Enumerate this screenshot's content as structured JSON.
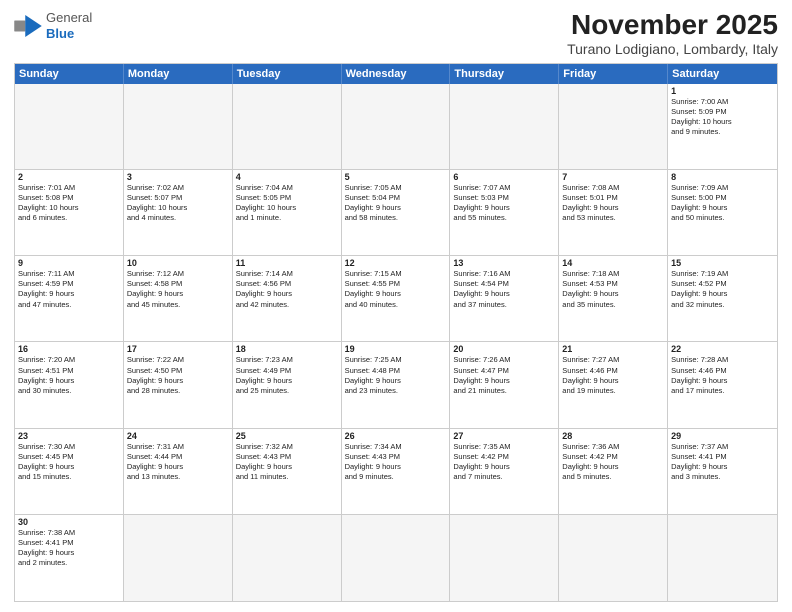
{
  "header": {
    "logo_general": "General",
    "logo_blue": "Blue",
    "month": "November 2025",
    "location": "Turano Lodigiano, Lombardy, Italy"
  },
  "weekdays": [
    "Sunday",
    "Monday",
    "Tuesday",
    "Wednesday",
    "Thursday",
    "Friday",
    "Saturday"
  ],
  "cells": [
    {
      "day": "",
      "content": "",
      "empty": true
    },
    {
      "day": "",
      "content": "",
      "empty": true
    },
    {
      "day": "",
      "content": "",
      "empty": true
    },
    {
      "day": "",
      "content": "",
      "empty": true
    },
    {
      "day": "",
      "content": "",
      "empty": true
    },
    {
      "day": "",
      "content": "",
      "empty": true
    },
    {
      "day": "1",
      "content": "Sunrise: 7:00 AM\nSunset: 5:09 PM\nDaylight: 10 hours\nand 9 minutes.",
      "empty": false
    },
    {
      "day": "2",
      "content": "Sunrise: 7:01 AM\nSunset: 5:08 PM\nDaylight: 10 hours\nand 6 minutes.",
      "empty": false
    },
    {
      "day": "3",
      "content": "Sunrise: 7:02 AM\nSunset: 5:07 PM\nDaylight: 10 hours\nand 4 minutes.",
      "empty": false
    },
    {
      "day": "4",
      "content": "Sunrise: 7:04 AM\nSunset: 5:05 PM\nDaylight: 10 hours\nand 1 minute.",
      "empty": false
    },
    {
      "day": "5",
      "content": "Sunrise: 7:05 AM\nSunset: 5:04 PM\nDaylight: 9 hours\nand 58 minutes.",
      "empty": false
    },
    {
      "day": "6",
      "content": "Sunrise: 7:07 AM\nSunset: 5:03 PM\nDaylight: 9 hours\nand 55 minutes.",
      "empty": false
    },
    {
      "day": "7",
      "content": "Sunrise: 7:08 AM\nSunset: 5:01 PM\nDaylight: 9 hours\nand 53 minutes.",
      "empty": false
    },
    {
      "day": "8",
      "content": "Sunrise: 7:09 AM\nSunset: 5:00 PM\nDaylight: 9 hours\nand 50 minutes.",
      "empty": false
    },
    {
      "day": "9",
      "content": "Sunrise: 7:11 AM\nSunset: 4:59 PM\nDaylight: 9 hours\nand 47 minutes.",
      "empty": false
    },
    {
      "day": "10",
      "content": "Sunrise: 7:12 AM\nSunset: 4:58 PM\nDaylight: 9 hours\nand 45 minutes.",
      "empty": false
    },
    {
      "day": "11",
      "content": "Sunrise: 7:14 AM\nSunset: 4:56 PM\nDaylight: 9 hours\nand 42 minutes.",
      "empty": false
    },
    {
      "day": "12",
      "content": "Sunrise: 7:15 AM\nSunset: 4:55 PM\nDaylight: 9 hours\nand 40 minutes.",
      "empty": false
    },
    {
      "day": "13",
      "content": "Sunrise: 7:16 AM\nSunset: 4:54 PM\nDaylight: 9 hours\nand 37 minutes.",
      "empty": false
    },
    {
      "day": "14",
      "content": "Sunrise: 7:18 AM\nSunset: 4:53 PM\nDaylight: 9 hours\nand 35 minutes.",
      "empty": false
    },
    {
      "day": "15",
      "content": "Sunrise: 7:19 AM\nSunset: 4:52 PM\nDaylight: 9 hours\nand 32 minutes.",
      "empty": false
    },
    {
      "day": "16",
      "content": "Sunrise: 7:20 AM\nSunset: 4:51 PM\nDaylight: 9 hours\nand 30 minutes.",
      "empty": false
    },
    {
      "day": "17",
      "content": "Sunrise: 7:22 AM\nSunset: 4:50 PM\nDaylight: 9 hours\nand 28 minutes.",
      "empty": false
    },
    {
      "day": "18",
      "content": "Sunrise: 7:23 AM\nSunset: 4:49 PM\nDaylight: 9 hours\nand 25 minutes.",
      "empty": false
    },
    {
      "day": "19",
      "content": "Sunrise: 7:25 AM\nSunset: 4:48 PM\nDaylight: 9 hours\nand 23 minutes.",
      "empty": false
    },
    {
      "day": "20",
      "content": "Sunrise: 7:26 AM\nSunset: 4:47 PM\nDaylight: 9 hours\nand 21 minutes.",
      "empty": false
    },
    {
      "day": "21",
      "content": "Sunrise: 7:27 AM\nSunset: 4:46 PM\nDaylight: 9 hours\nand 19 minutes.",
      "empty": false
    },
    {
      "day": "22",
      "content": "Sunrise: 7:28 AM\nSunset: 4:46 PM\nDaylight: 9 hours\nand 17 minutes.",
      "empty": false
    },
    {
      "day": "23",
      "content": "Sunrise: 7:30 AM\nSunset: 4:45 PM\nDaylight: 9 hours\nand 15 minutes.",
      "empty": false
    },
    {
      "day": "24",
      "content": "Sunrise: 7:31 AM\nSunset: 4:44 PM\nDaylight: 9 hours\nand 13 minutes.",
      "empty": false
    },
    {
      "day": "25",
      "content": "Sunrise: 7:32 AM\nSunset: 4:43 PM\nDaylight: 9 hours\nand 11 minutes.",
      "empty": false
    },
    {
      "day": "26",
      "content": "Sunrise: 7:34 AM\nSunset: 4:43 PM\nDaylight: 9 hours\nand 9 minutes.",
      "empty": false
    },
    {
      "day": "27",
      "content": "Sunrise: 7:35 AM\nSunset: 4:42 PM\nDaylight: 9 hours\nand 7 minutes.",
      "empty": false
    },
    {
      "day": "28",
      "content": "Sunrise: 7:36 AM\nSunset: 4:42 PM\nDaylight: 9 hours\nand 5 minutes.",
      "empty": false
    },
    {
      "day": "29",
      "content": "Sunrise: 7:37 AM\nSunset: 4:41 PM\nDaylight: 9 hours\nand 3 minutes.",
      "empty": false
    },
    {
      "day": "30",
      "content": "Sunrise: 7:38 AM\nSunset: 4:41 PM\nDaylight: 9 hours\nand 2 minutes.",
      "empty": false
    },
    {
      "day": "",
      "content": "",
      "empty": true
    },
    {
      "day": "",
      "content": "",
      "empty": true
    },
    {
      "day": "",
      "content": "",
      "empty": true
    },
    {
      "day": "",
      "content": "",
      "empty": true
    },
    {
      "day": "",
      "content": "",
      "empty": true
    },
    {
      "day": "",
      "content": "",
      "empty": true
    }
  ]
}
